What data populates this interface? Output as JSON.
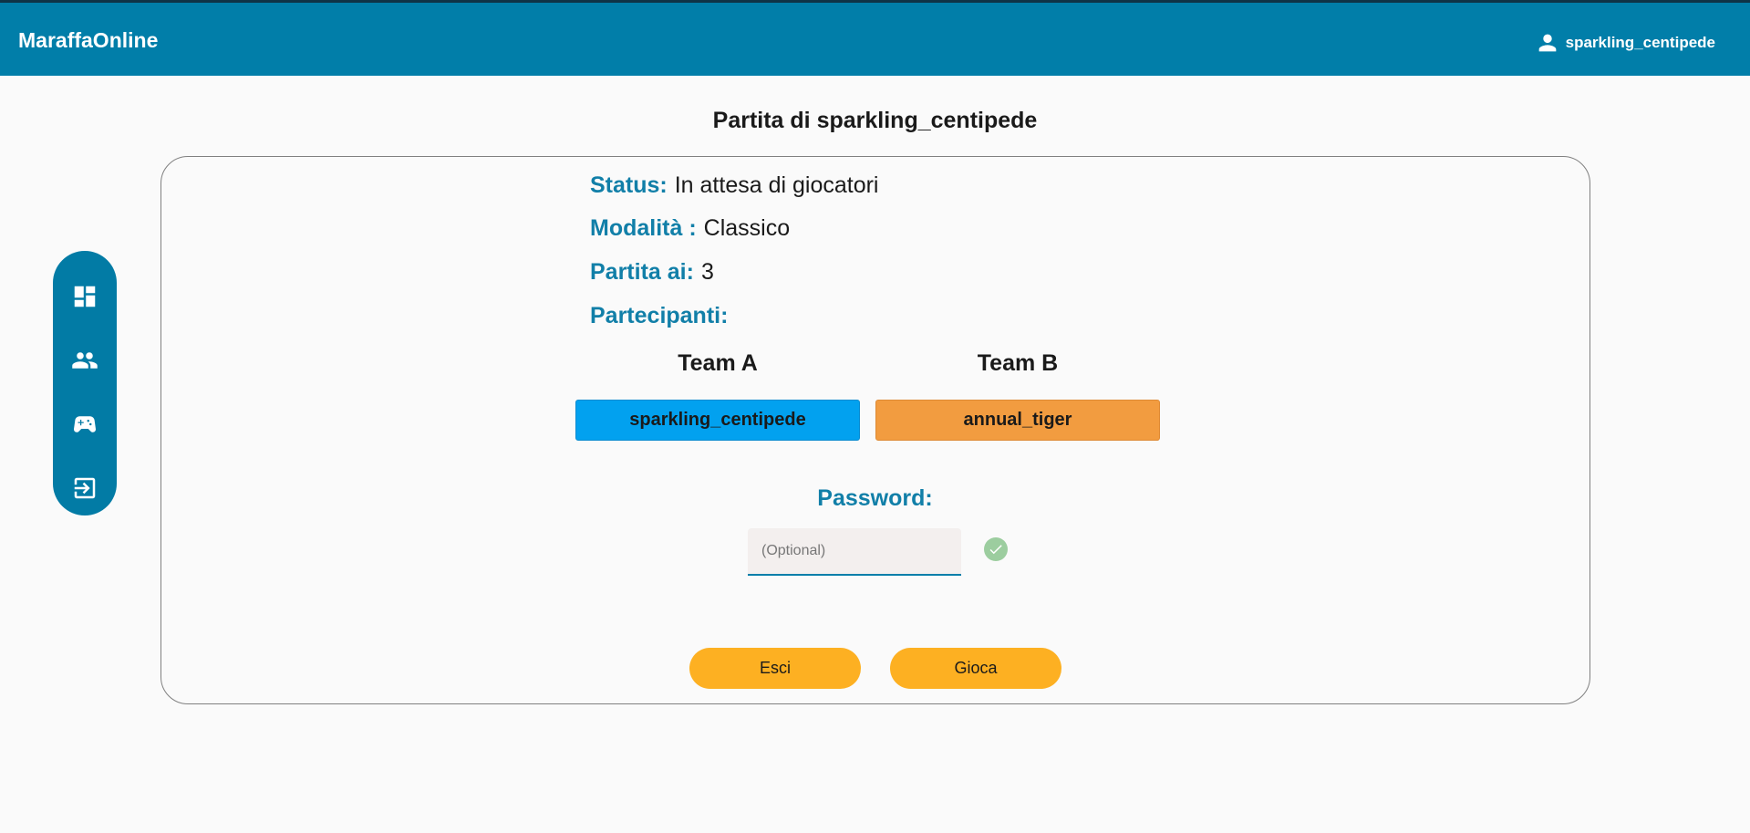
{
  "header": {
    "brand": "MaraffaOnline",
    "username": "sparkling_centipede"
  },
  "sidebar": {
    "items": [
      {
        "icon": "dashboard-icon"
      },
      {
        "icon": "people-icon"
      },
      {
        "icon": "gamepad-icon"
      },
      {
        "icon": "logout-icon"
      }
    ]
  },
  "page": {
    "title": "Partita di sparkling_centipede"
  },
  "game": {
    "status_label": "Status:",
    "status_value": "In attesa di giocatori",
    "mode_label": "Modalità :",
    "mode_value": "Classico",
    "points_label": "Partita ai:",
    "points_value": "3",
    "participants_label": "Partecipanti:"
  },
  "teams": {
    "a_label": "Team A",
    "b_label": "Team B",
    "a_players": [
      "sparkling_centipede"
    ],
    "b_players": [
      "annual_tiger"
    ]
  },
  "password": {
    "label": "Password:",
    "placeholder": "(Optional)",
    "value": ""
  },
  "actions": {
    "exit_label": "Esci",
    "play_label": "Gioca"
  },
  "colors": {
    "primary": "#017ea9",
    "team_a": "#02a1ef",
    "team_b": "#f29c40",
    "button": "#fdb022",
    "check": "#9ccd9f"
  }
}
